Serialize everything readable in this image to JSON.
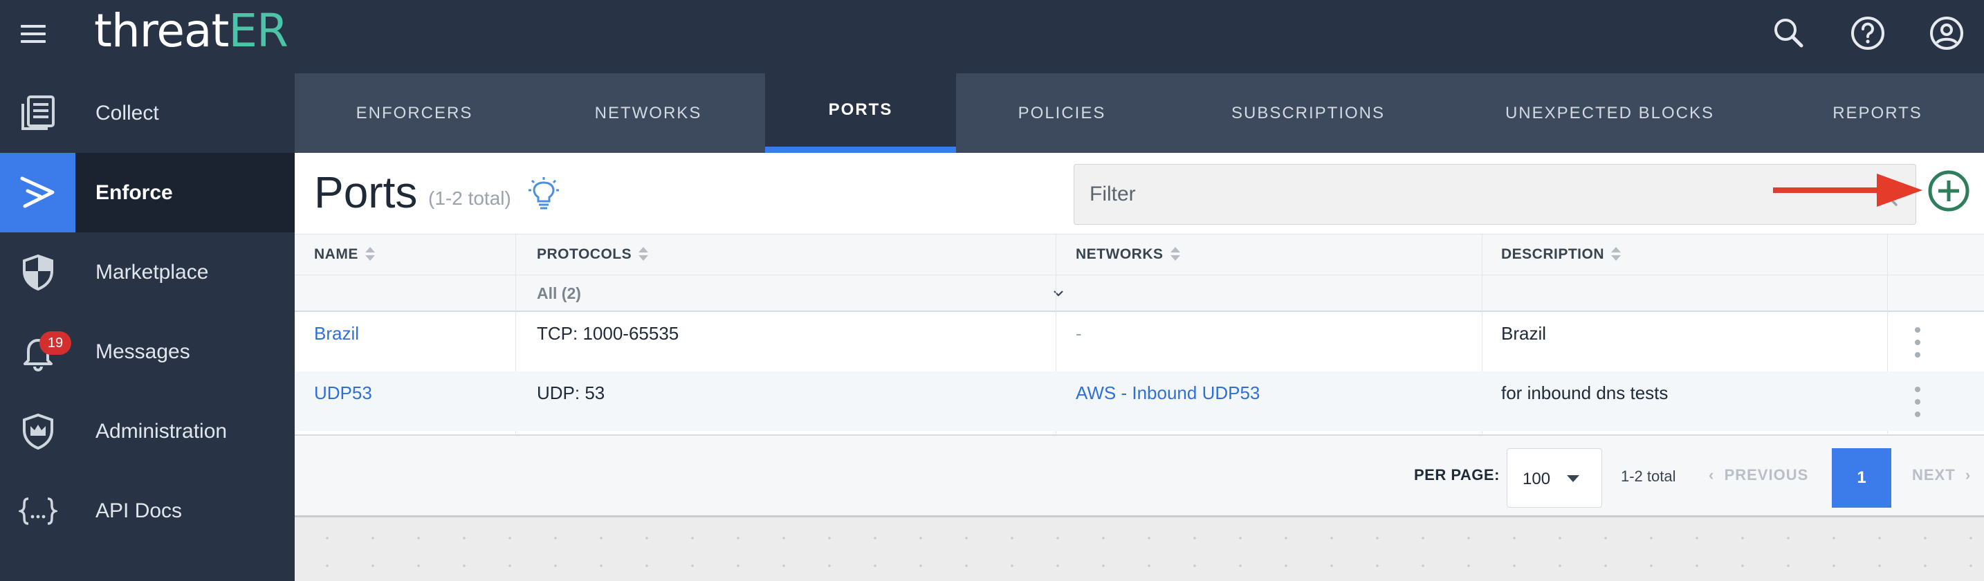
{
  "app": {
    "logo_text": "threatER",
    "logo_main": "threat",
    "logo_accent": "ER",
    "accent_color": "#3b7bea",
    "brand_color": "#4cc4a8",
    "topbar_icons": [
      "search-icon",
      "help-icon",
      "account-icon"
    ]
  },
  "sidebar": {
    "items": [
      {
        "label": "Collect",
        "icon": "collect-icon",
        "active": false
      },
      {
        "label": "Enforce",
        "icon": "enforce-icon",
        "active": true
      },
      {
        "label": "Marketplace",
        "icon": "shield-icon",
        "active": false
      },
      {
        "label": "Messages",
        "icon": "bell-icon",
        "active": false,
        "badge": "19"
      },
      {
        "label": "Administration",
        "icon": "crown-shield-icon",
        "active": false
      },
      {
        "label": "API Docs",
        "icon": "braces-icon",
        "active": false
      }
    ]
  },
  "tabs": [
    {
      "label": "ENFORCERS",
      "active": false
    },
    {
      "label": "NETWORKS",
      "active": false
    },
    {
      "label": "PORTS",
      "active": true
    },
    {
      "label": "POLICIES",
      "active": false
    },
    {
      "label": "SUBSCRIPTIONS",
      "active": false
    },
    {
      "label": "UNEXPECTED BLOCKS",
      "active": false
    },
    {
      "label": "REPORTS",
      "active": false
    }
  ],
  "header": {
    "title": "Ports",
    "count": "(1-2 total)",
    "filter_placeholder": "Filter"
  },
  "table": {
    "columns": [
      "NAME",
      "PROTOCOLS",
      "NETWORKS",
      "DESCRIPTION"
    ],
    "protocol_filter": "All (2)",
    "rows": [
      {
        "name": "Brazil",
        "protocols": "TCP: 1000-65535",
        "networks": "-",
        "description": "Brazil"
      },
      {
        "name": "UDP53",
        "protocols": "UDP: 53",
        "networks": "AWS - Inbound UDP53",
        "description": "for inbound dns tests"
      }
    ]
  },
  "pagination": {
    "per_page_label": "PER PAGE:",
    "per_page_value": "100",
    "total": "1-2 total",
    "previous": "PREVIOUS",
    "current_page": "1",
    "next": "NEXT"
  }
}
